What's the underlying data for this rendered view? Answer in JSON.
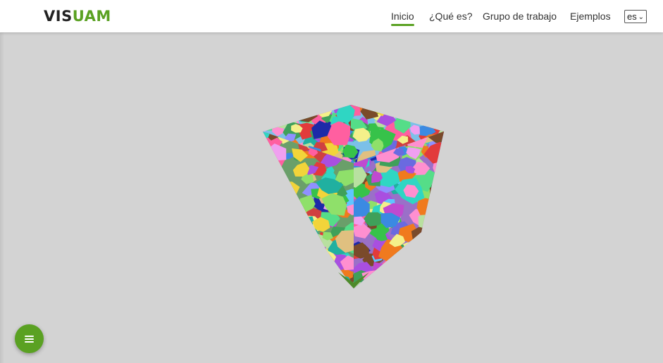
{
  "brand": {
    "part1": "VIS",
    "part2": "UAM"
  },
  "nav": {
    "items": [
      {
        "label": "Inicio",
        "active": true
      },
      {
        "label": "¿Qué es?",
        "active": false
      },
      {
        "label": "Grupo de trabajo",
        "active": false
      },
      {
        "label": "Ejemplos",
        "active": false
      }
    ],
    "language": {
      "selected": "es"
    }
  },
  "colors": {
    "accent": "#5aa122",
    "background": "#d3d3d3"
  },
  "viewer": {
    "object": "voronoi-grain-cube"
  },
  "fab": {
    "icon": "menu-icon"
  }
}
